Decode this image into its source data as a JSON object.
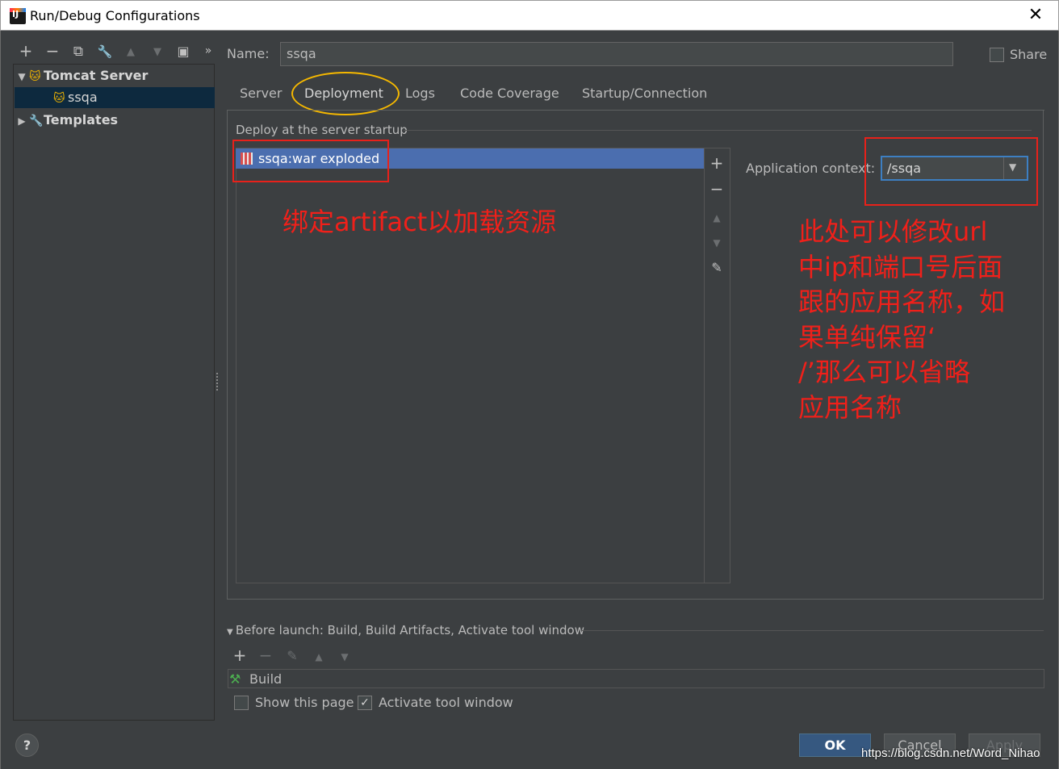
{
  "window": {
    "title": "Run/Debug Configurations",
    "close": "✕"
  },
  "toolbar": {
    "add": "+",
    "remove": "−",
    "copy": "⧉",
    "wrench": "🔧",
    "up": "▲",
    "down": "▼",
    "folder": "▣",
    "more": "»"
  },
  "tree": {
    "tomcat_label": "Tomcat Server",
    "ssqa_label": "ssqa",
    "templates_label": "Templates"
  },
  "name": {
    "label": "Name:",
    "value": "ssqa"
  },
  "share": {
    "label": "Share"
  },
  "tabs": [
    {
      "label": "Server"
    },
    {
      "label": "Deployment"
    },
    {
      "label": "Logs"
    },
    {
      "label": "Code Coverage"
    },
    {
      "label": "Startup/Connection"
    }
  ],
  "deploy": {
    "section_title": "Deploy at the server startup",
    "artifact": "ssqa:war exploded",
    "app_context_label": "Application context:",
    "app_context_value": "/ssqa"
  },
  "annotations": {
    "left": "绑定artifact以加载资源",
    "right": "此处可以修改url\n中ip和端口号后面\n跟的应用名称，如\n果单纯保留‘\n/’那么可以省略\n应用名称"
  },
  "before_launch": {
    "title": "Before launch: Build, Build Artifacts, Activate tool window",
    "task": "Build",
    "show_page_label": "Show this page",
    "show_page_checked": false,
    "activate_label": "Activate tool window",
    "activate_checked": true
  },
  "buttons": {
    "help": "?",
    "ok": "OK",
    "cancel": "Cancel",
    "apply": "Apply"
  },
  "watermark": "https://blog.csdn.net/Word_Nihao",
  "colors": {
    "accent": "#4b6eaf",
    "annotation": "#f0201a",
    "highlight_ellipse": "#f5b800",
    "background": "#3c3f41"
  }
}
